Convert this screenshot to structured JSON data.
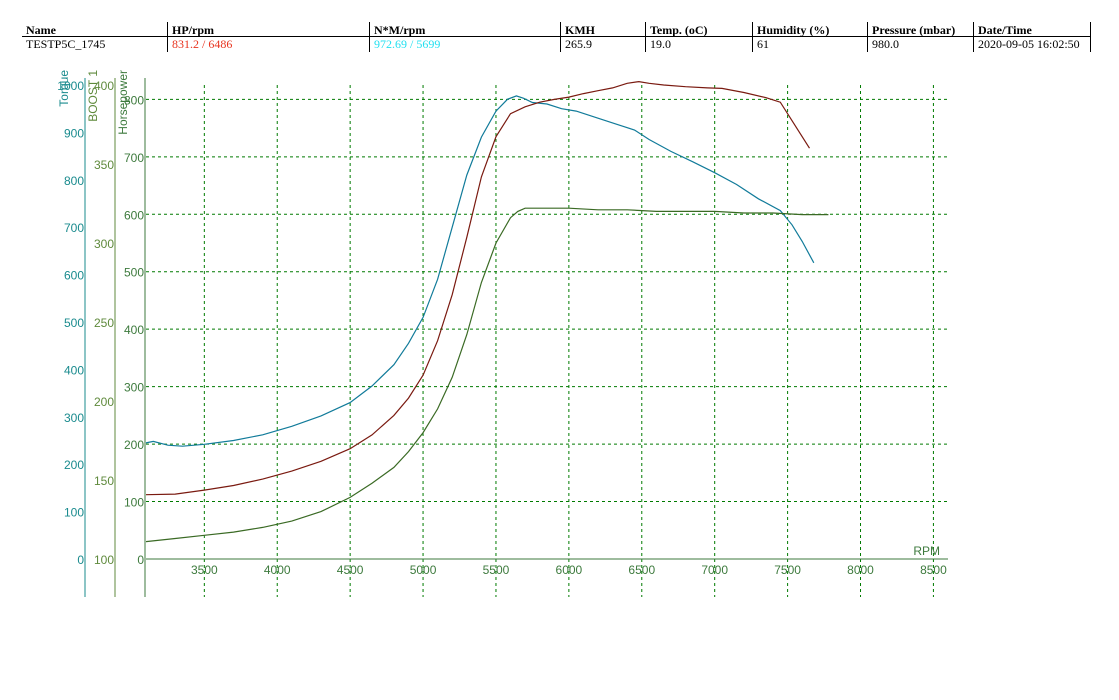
{
  "header": {
    "columns": [
      {
        "name": "Name",
        "value": "TESTP5C_1745",
        "color": "#000000"
      },
      {
        "name": "HP/rpm",
        "value": "831.2 / 6486",
        "color": "#e8341f"
      },
      {
        "name": "N*M/rpm",
        "value": "972.69 / 5699",
        "color": "#22e0f0"
      },
      {
        "name": "KMH",
        "value": "265.9",
        "color": "#000000"
      },
      {
        "name": "Temp. (oC)",
        "value": "19.0",
        "color": "#000000"
      },
      {
        "name": "Humidity (%)",
        "value": "61",
        "color": "#000000"
      },
      {
        "name": "Pressure (mbar)",
        "value": "980.0",
        "color": "#000000"
      },
      {
        "name": "Date/Time",
        "value": "2020-09-05 16:02:50",
        "color": "#000000"
      }
    ]
  },
  "chart_data": {
    "type": "line",
    "xlabel": "RPM",
    "xlim": [
      3100,
      8600
    ],
    "xticks": [
      3500,
      4000,
      4500,
      5000,
      5500,
      6000,
      6500,
      7000,
      7500,
      8000,
      8500
    ],
    "grid": true,
    "grid_color": "#007a00",
    "axes": [
      {
        "id": "torque",
        "label": "Torque",
        "color": "#1a8b8e",
        "ylim": [
          0,
          1000
        ],
        "ticks": [
          0,
          100,
          200,
          300,
          400,
          500,
          600,
          700,
          800,
          900,
          1000
        ]
      },
      {
        "id": "boost",
        "label": "BOOST 1",
        "color": "#5f8a3c",
        "ylim": [
          100,
          400
        ],
        "ticks": [
          100,
          150,
          200,
          250,
          300,
          350,
          400
        ]
      },
      {
        "id": "hp",
        "label": "Horsepower",
        "color": "#3d7a3d",
        "ylim": [
          0,
          825
        ],
        "ticks": [
          0,
          100,
          200,
          300,
          400,
          500,
          600,
          700,
          800
        ]
      }
    ],
    "series": [
      {
        "axis": "torque",
        "color": "#117b9a",
        "x": [
          3100,
          3150,
          3250,
          3350,
          3500,
          3700,
          3900,
          4100,
          4300,
          4500,
          4650,
          4800,
          4900,
          5000,
          5100,
          5200,
          5300,
          5400,
          5500,
          5580,
          5640,
          5690,
          5750,
          5850,
          5950,
          6050,
          6200,
          6350,
          6450,
          6550,
          6700,
          6850,
          7000,
          7150,
          7300,
          7450,
          7530,
          7600,
          7680
        ],
        "y": [
          245,
          248,
          240,
          238,
          242,
          250,
          262,
          280,
          302,
          330,
          365,
          410,
          455,
          510,
          590,
          700,
          810,
          890,
          945,
          970,
          977,
          972,
          963,
          960,
          950,
          945,
          930,
          915,
          905,
          885,
          860,
          838,
          815,
          790,
          760,
          735,
          705,
          670,
          625
        ]
      },
      {
        "axis": "hp",
        "color": "#7a1a10",
        "x": [
          3100,
          3300,
          3500,
          3700,
          3900,
          4100,
          4300,
          4500,
          4650,
          4800,
          4900,
          5000,
          5100,
          5200,
          5300,
          5400,
          5500,
          5600,
          5700,
          5800,
          5900,
          6000,
          6100,
          6200,
          6300,
          6400,
          6480,
          6550,
          6650,
          6800,
          6950,
          7050,
          7200,
          7350,
          7450,
          7550,
          7650
        ],
        "y": [
          112,
          113,
          120,
          128,
          139,
          153,
          170,
          192,
          216,
          250,
          280,
          320,
          380,
          460,
          560,
          665,
          735,
          775,
          787,
          795,
          800,
          804,
          810,
          815,
          820,
          828,
          831,
          828,
          825,
          822,
          820,
          819,
          812,
          803,
          795,
          755,
          715
        ]
      },
      {
        "axis": "boost",
        "color": "#3a6a24",
        "x": [
          3100,
          3300,
          3500,
          3700,
          3900,
          4100,
          4300,
          4500,
          4650,
          4800,
          4900,
          5000,
          5100,
          5200,
          5300,
          5400,
          5500,
          5600,
          5650,
          5700,
          5800,
          6000,
          6200,
          6400,
          6600,
          6800,
          7000,
          7200,
          7400,
          7600,
          7700,
          7780
        ],
        "y": [
          111,
          113,
          115,
          117,
          120,
          124,
          130,
          139,
          148,
          158,
          168,
          180,
          195,
          215,
          242,
          275,
          300,
          316,
          320,
          322,
          322,
          322,
          321,
          321,
          320,
          320,
          320,
          319,
          319,
          318,
          318,
          318
        ]
      }
    ]
  }
}
